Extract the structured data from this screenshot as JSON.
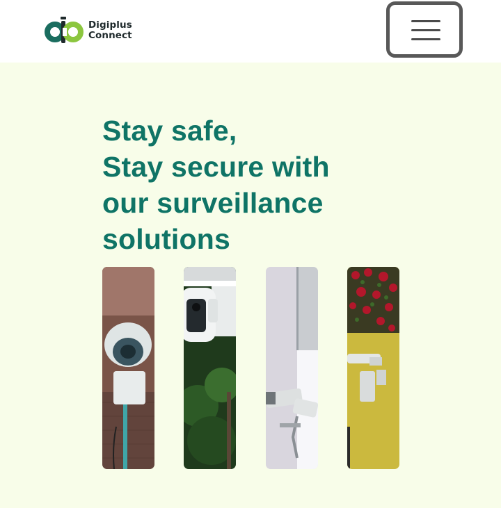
{
  "brand": {
    "line1": "Digiplus",
    "line2": "Connect",
    "colors": {
      "dark": "#1a6d5f",
      "light": "#8cc63f"
    }
  },
  "header": {
    "menu_icon": "hamburger-icon"
  },
  "hero": {
    "headline": [
      "Stay safe,",
      "Stay secure with",
      "our surveillance",
      "solutions"
    ],
    "background": "#f8fde9",
    "text_color": "#0f7466"
  },
  "gallery": [
    {
      "name": "dome-camera-on-brick-wall"
    },
    {
      "name": "white-smart-camera-under-roof"
    },
    {
      "name": "bullet-cameras-on-white-wall"
    },
    {
      "name": "camera-on-yellow-wall-with-flowers"
    }
  ]
}
